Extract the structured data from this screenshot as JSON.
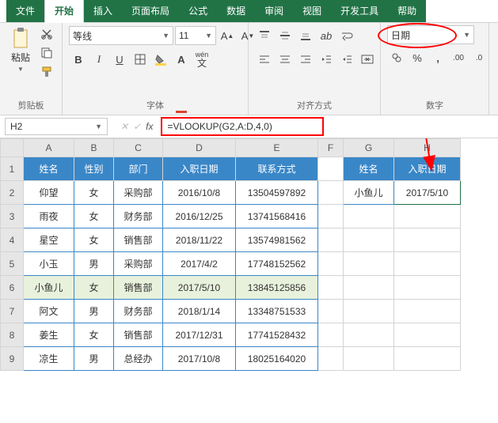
{
  "tabs": {
    "file": "文件",
    "home": "开始",
    "insert": "插入",
    "layout": "页面布局",
    "formula": "公式",
    "data": "数据",
    "review": "审阅",
    "view": "视图",
    "dev": "开发工具",
    "help": "帮助"
  },
  "ribbon": {
    "clipboard": {
      "label": "剪贴板",
      "paste": "粘贴"
    },
    "font": {
      "label": "字体",
      "name": "等线",
      "size": "11"
    },
    "align": {
      "label": "对齐方式"
    },
    "number": {
      "label": "数字",
      "format": "日期"
    }
  },
  "formulabar": {
    "cellref": "H2",
    "formula": "=VLOOKUP(G2,A:D,4,0)"
  },
  "sheet": {
    "cols": [
      "A",
      "B",
      "C",
      "D",
      "E",
      "F",
      "G",
      "H"
    ],
    "headers": {
      "A": "姓名",
      "B": "性别",
      "C": "部门",
      "D": "入职日期",
      "E": "联系方式",
      "G": "姓名",
      "H": "入职日期"
    },
    "rows": [
      {
        "n": "2",
        "A": "仰望",
        "B": "女",
        "C": "采购部",
        "D": "2016/10/8",
        "E": "13504597892",
        "G": "小鱼儿",
        "H": "2017/5/10"
      },
      {
        "n": "3",
        "A": "雨夜",
        "B": "女",
        "C": "财务部",
        "D": "2016/12/25",
        "E": "13741568416"
      },
      {
        "n": "4",
        "A": "星空",
        "B": "女",
        "C": "销售部",
        "D": "2018/11/22",
        "E": "13574981562"
      },
      {
        "n": "5",
        "A": "小玉",
        "B": "男",
        "C": "采购部",
        "D": "2017/4/2",
        "E": "17748152562"
      },
      {
        "n": "6",
        "A": "小鱼儿",
        "B": "女",
        "C": "销售部",
        "D": "2017/5/10",
        "E": "13845125856"
      },
      {
        "n": "7",
        "A": "阿文",
        "B": "男",
        "C": "财务部",
        "D": "2018/1/14",
        "E": "13348751533"
      },
      {
        "n": "8",
        "A": "姜生",
        "B": "女",
        "C": "销售部",
        "D": "2017/12/31",
        "E": "17741528432"
      },
      {
        "n": "9",
        "A": "凉生",
        "B": "男",
        "C": "总经办",
        "D": "2017/10/8",
        "E": "18025164020"
      }
    ]
  }
}
